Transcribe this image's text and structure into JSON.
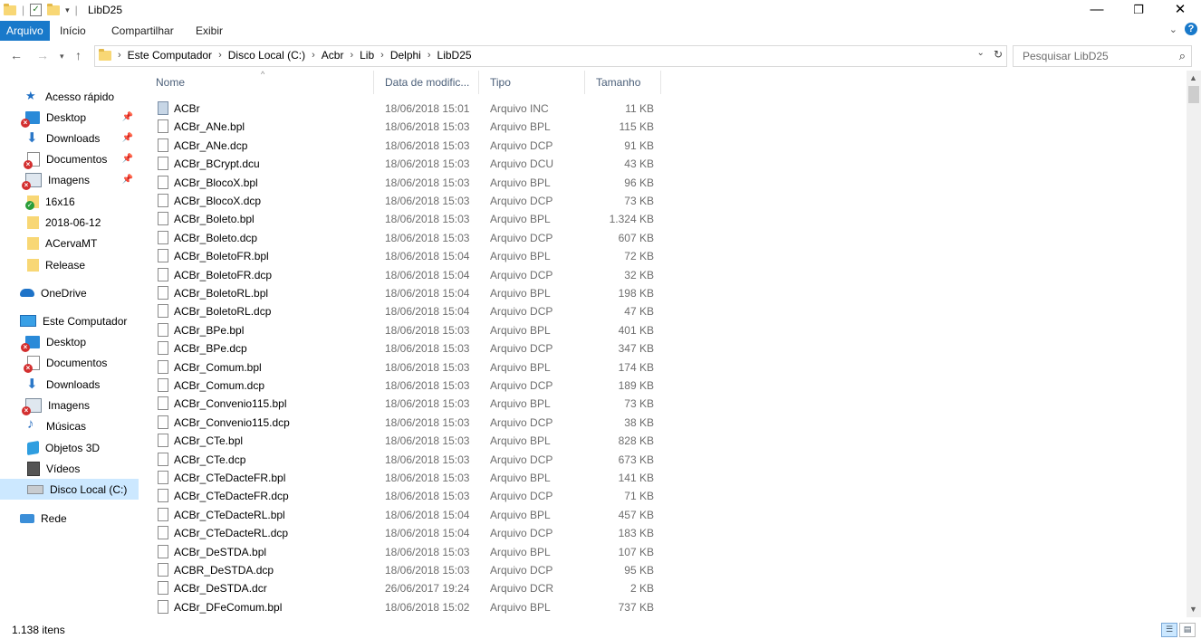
{
  "window": {
    "title": "LibD25",
    "minimize": "—",
    "restore": "❐",
    "close": "✕"
  },
  "ribbon": {
    "tabs": [
      "Arquivo",
      "Início",
      "Compartilhar",
      "Exibir"
    ],
    "active": "Arquivo"
  },
  "address": {
    "breadcrumbs": [
      "Este Computador",
      "Disco Local (C:)",
      "Acbr",
      "Lib",
      "Delphi",
      "LibD25"
    ]
  },
  "search": {
    "placeholder": "Pesquisar LibD25"
  },
  "nav": {
    "items": [
      {
        "label": "Acesso rápido",
        "icon": "quick-access-star-icon"
      },
      {
        "label": "Desktop",
        "icon": "desktop-icon",
        "pinned": true,
        "badge": "error"
      },
      {
        "label": "Downloads",
        "icon": "downloads-icon",
        "pinned": true
      },
      {
        "label": "Documentos",
        "icon": "documents-icon",
        "pinned": true,
        "badge": "error"
      },
      {
        "label": "Imagens",
        "icon": "pictures-icon",
        "pinned": true,
        "badge": "error"
      },
      {
        "label": "16x16",
        "icon": "folder-icon",
        "badge": "ok"
      },
      {
        "label": "2018-06-12",
        "icon": "folder-icon"
      },
      {
        "label": "ACervaMT",
        "icon": "folder-icon"
      },
      {
        "label": "Release",
        "icon": "folder-icon"
      },
      {
        "label": "OneDrive",
        "icon": "onedrive-icon"
      },
      {
        "label": "Este Computador",
        "icon": "this-pc-icon"
      },
      {
        "label": "Desktop",
        "icon": "desktop-icon",
        "badge": "error"
      },
      {
        "label": "Documentos",
        "icon": "documents-icon",
        "badge": "error"
      },
      {
        "label": "Downloads",
        "icon": "downloads-icon"
      },
      {
        "label": "Imagens",
        "icon": "pictures-icon",
        "badge": "error"
      },
      {
        "label": "Músicas",
        "icon": "music-icon"
      },
      {
        "label": "Objetos 3D",
        "icon": "3d-objects-icon"
      },
      {
        "label": "Vídeos",
        "icon": "videos-icon"
      },
      {
        "label": "Disco Local (C:)",
        "icon": "local-disk-icon",
        "selected": true
      },
      {
        "label": "Rede",
        "icon": "network-icon"
      }
    ]
  },
  "columns": {
    "name": "Nome",
    "date": "Data de modific...",
    "type": "Tipo",
    "size": "Tamanho"
  },
  "files": [
    {
      "name": "ACBr",
      "date": "18/06/2018 15:01",
      "type": "Arquivo INC",
      "size": "11 KB"
    },
    {
      "name": "ACBr_ANe.bpl",
      "date": "18/06/2018 15:03",
      "type": "Arquivo BPL",
      "size": "115 KB"
    },
    {
      "name": "ACBr_ANe.dcp",
      "date": "18/06/2018 15:03",
      "type": "Arquivo DCP",
      "size": "91 KB"
    },
    {
      "name": "ACBr_BCrypt.dcu",
      "date": "18/06/2018 15:03",
      "type": "Arquivo DCU",
      "size": "43 KB"
    },
    {
      "name": "ACBr_BlocoX.bpl",
      "date": "18/06/2018 15:03",
      "type": "Arquivo BPL",
      "size": "96 KB"
    },
    {
      "name": "ACBr_BlocoX.dcp",
      "date": "18/06/2018 15:03",
      "type": "Arquivo DCP",
      "size": "73 KB"
    },
    {
      "name": "ACBr_Boleto.bpl",
      "date": "18/06/2018 15:03",
      "type": "Arquivo BPL",
      "size": "1.324 KB"
    },
    {
      "name": "ACBr_Boleto.dcp",
      "date": "18/06/2018 15:03",
      "type": "Arquivo DCP",
      "size": "607 KB"
    },
    {
      "name": "ACBr_BoletoFR.bpl",
      "date": "18/06/2018 15:04",
      "type": "Arquivo BPL",
      "size": "72 KB"
    },
    {
      "name": "ACBr_BoletoFR.dcp",
      "date": "18/06/2018 15:04",
      "type": "Arquivo DCP",
      "size": "32 KB"
    },
    {
      "name": "ACBr_BoletoRL.bpl",
      "date": "18/06/2018 15:04",
      "type": "Arquivo BPL",
      "size": "198 KB"
    },
    {
      "name": "ACBr_BoletoRL.dcp",
      "date": "18/06/2018 15:04",
      "type": "Arquivo DCP",
      "size": "47 KB"
    },
    {
      "name": "ACBr_BPe.bpl",
      "date": "18/06/2018 15:03",
      "type": "Arquivo BPL",
      "size": "401 KB"
    },
    {
      "name": "ACBr_BPe.dcp",
      "date": "18/06/2018 15:03",
      "type": "Arquivo DCP",
      "size": "347 KB"
    },
    {
      "name": "ACBr_Comum.bpl",
      "date": "18/06/2018 15:03",
      "type": "Arquivo BPL",
      "size": "174 KB"
    },
    {
      "name": "ACBr_Comum.dcp",
      "date": "18/06/2018 15:03",
      "type": "Arquivo DCP",
      "size": "189 KB"
    },
    {
      "name": "ACBr_Convenio115.bpl",
      "date": "18/06/2018 15:03",
      "type": "Arquivo BPL",
      "size": "73 KB"
    },
    {
      "name": "ACBr_Convenio115.dcp",
      "date": "18/06/2018 15:03",
      "type": "Arquivo DCP",
      "size": "38 KB"
    },
    {
      "name": "ACBr_CTe.bpl",
      "date": "18/06/2018 15:03",
      "type": "Arquivo BPL",
      "size": "828 KB"
    },
    {
      "name": "ACBr_CTe.dcp",
      "date": "18/06/2018 15:03",
      "type": "Arquivo DCP",
      "size": "673 KB"
    },
    {
      "name": "ACBr_CTeDacteFR.bpl",
      "date": "18/06/2018 15:03",
      "type": "Arquivo BPL",
      "size": "141 KB"
    },
    {
      "name": "ACBr_CTeDacteFR.dcp",
      "date": "18/06/2018 15:03",
      "type": "Arquivo DCP",
      "size": "71 KB"
    },
    {
      "name": "ACBr_CTeDacteRL.bpl",
      "date": "18/06/2018 15:04",
      "type": "Arquivo BPL",
      "size": "457 KB"
    },
    {
      "name": "ACBr_CTeDacteRL.dcp",
      "date": "18/06/2018 15:04",
      "type": "Arquivo DCP",
      "size": "183 KB"
    },
    {
      "name": "ACBr_DeSTDA.bpl",
      "date": "18/06/2018 15:03",
      "type": "Arquivo BPL",
      "size": "107 KB"
    },
    {
      "name": "ACBR_DeSTDA.dcp",
      "date": "18/06/2018 15:03",
      "type": "Arquivo DCP",
      "size": "95 KB"
    },
    {
      "name": "ACBr_DeSTDA.dcr",
      "date": "26/06/2017 19:24",
      "type": "Arquivo DCR",
      "size": "2 KB"
    },
    {
      "name": "ACBr_DFeComum.bpl",
      "date": "18/06/2018 15:02",
      "type": "Arquivo BPL",
      "size": "737 KB"
    }
  ],
  "status": {
    "count": "1.138 itens"
  },
  "colors": {
    "accent": "#1979ca",
    "selection": "#cce8ff",
    "header_text": "#4c607a"
  }
}
